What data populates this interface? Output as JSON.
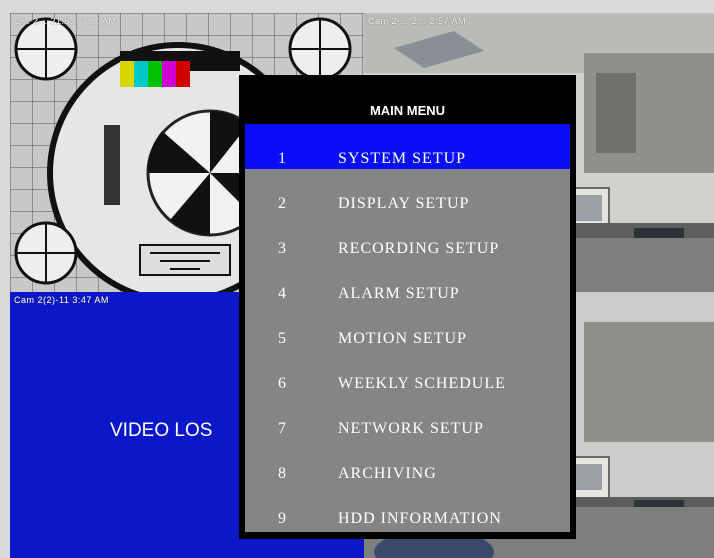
{
  "osd": {
    "cam1": "C... 2... 21:5... 7:... AM",
    "cam2": "Cam 2 ... 2... 2:57 AM",
    "cam3": "Cam  2(2)-11 3:47 AM"
  },
  "video_loss": "VIDEO LOS",
  "menu": {
    "title": "MAIN MENU",
    "items": [
      {
        "num": "1",
        "label": "SYSTEM SETUP"
      },
      {
        "num": "2",
        "label": "DISPLAY SETUP"
      },
      {
        "num": "3",
        "label": "RECORDING SETUP"
      },
      {
        "num": "4",
        "label": "ALARM SETUP"
      },
      {
        "num": "5",
        "label": "MOTION SETUP"
      },
      {
        "num": "6",
        "label": "WEEKLY SCHEDULE"
      },
      {
        "num": "7",
        "label": "NETWORK SETUP"
      },
      {
        "num": "8",
        "label": "ARCHIVING"
      },
      {
        "num": "9",
        "label": "HDD INFORMATION"
      }
    ],
    "selected_index": 0
  },
  "colors": {
    "selected_item": "#0a0ef7",
    "menu_body": "#858585",
    "video_loss_bg": "#0b17c9"
  }
}
